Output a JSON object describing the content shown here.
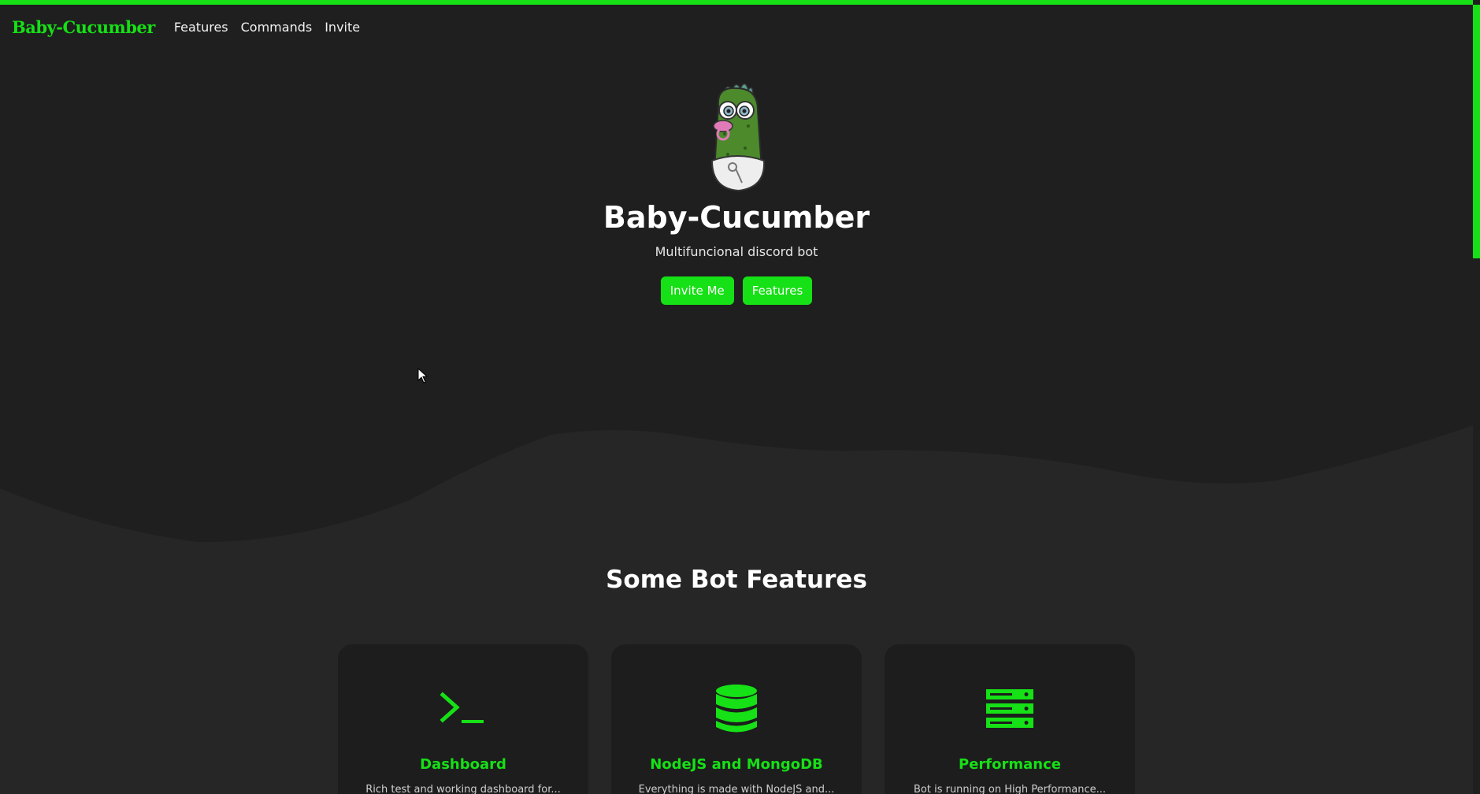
{
  "brand": {
    "name": "Baby-Cucumber"
  },
  "nav": {
    "items": [
      "Features",
      "Commands",
      "Invite"
    ]
  },
  "hero": {
    "title": "Baby-Cucumber",
    "subtitle": "Multifuncional discord bot",
    "buttons": [
      "Invite Me",
      "Features"
    ]
  },
  "features_section": {
    "title": "Some Bot Features",
    "cards": [
      {
        "icon": "terminal-icon",
        "title": "Dashboard",
        "text": "Rich test and working dashboard for..."
      },
      {
        "icon": "database-icon",
        "title": "NodeJS and MongoDB",
        "text": "Everything is made with NodeJS and..."
      },
      {
        "icon": "server-icon",
        "title": "Performance",
        "text": "Bot is running on High Performance..."
      }
    ]
  },
  "colors": {
    "accent": "#16e016",
    "background": "#1f1f1f",
    "card": "#1d1d1d",
    "lower_band": "#262626"
  }
}
